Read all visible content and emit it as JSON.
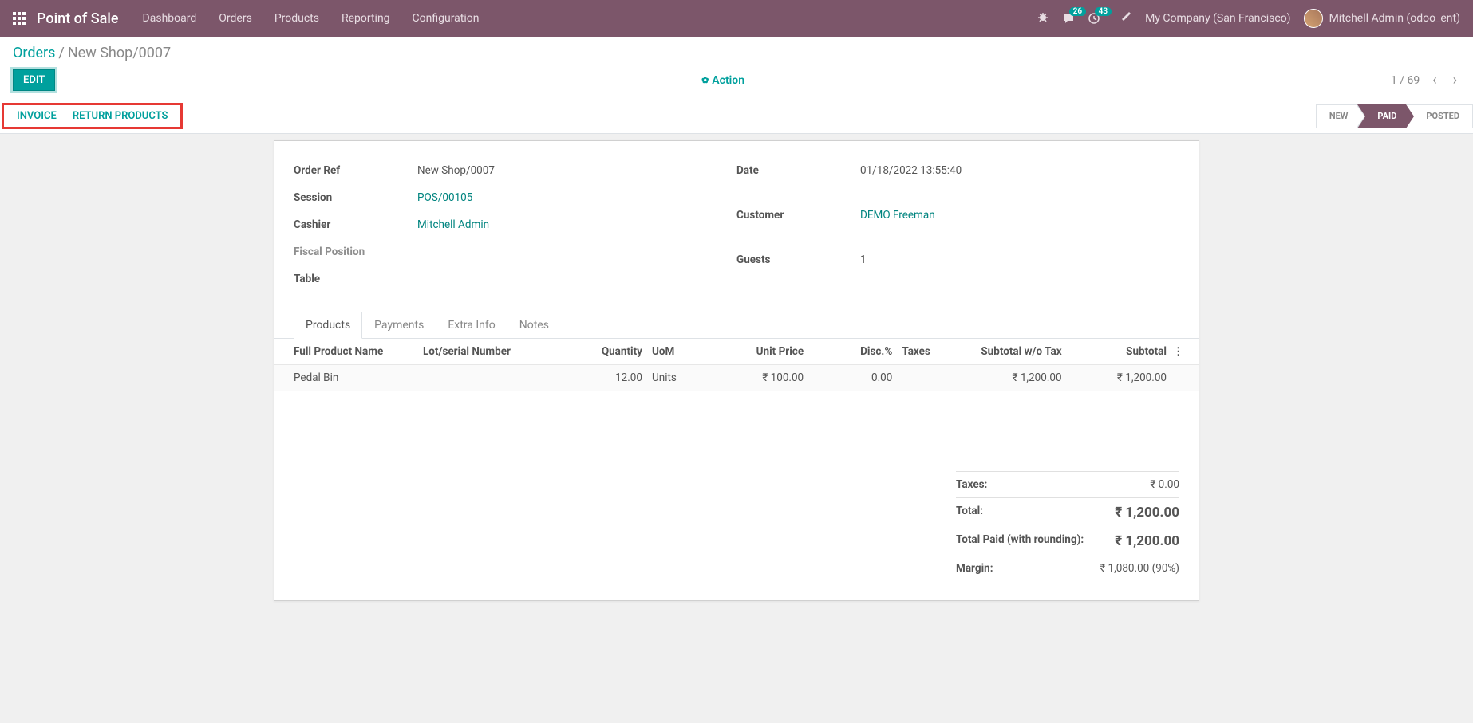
{
  "nav": {
    "app_title": "Point of Sale",
    "items": [
      "Dashboard",
      "Orders",
      "Products",
      "Reporting",
      "Configuration"
    ],
    "chat_count": "26",
    "activity_count": "43",
    "company": "My Company (San Francisco)",
    "user": "Mitchell Admin (odoo_ent)"
  },
  "breadcrumb": {
    "parent": "Orders",
    "current": "New Shop/0007"
  },
  "controls": {
    "edit": "EDIT",
    "action": "Action",
    "pager": "1 / 69"
  },
  "action_bar": {
    "invoice": "INVOICE",
    "return_products": "RETURN PRODUCTS"
  },
  "status_steps": [
    "NEW",
    "PAID",
    "POSTED"
  ],
  "fields": {
    "order_ref_label": "Order Ref",
    "order_ref": "New Shop/0007",
    "session_label": "Session",
    "session": "POS/00105",
    "cashier_label": "Cashier",
    "cashier": "Mitchell Admin",
    "fiscal_label": "Fiscal Position",
    "table_label": "Table",
    "date_label": "Date",
    "date": "01/18/2022 13:55:40",
    "customer_label": "Customer",
    "customer": "DEMO Freeman",
    "guests_label": "Guests",
    "guests": "1"
  },
  "tabs": [
    "Products",
    "Payments",
    "Extra Info",
    "Notes"
  ],
  "table": {
    "headers": {
      "product": "Full Product Name",
      "lot": "Lot/serial Number",
      "qty": "Quantity",
      "uom": "UoM",
      "unit_price": "Unit Price",
      "disc": "Disc.%",
      "taxes": "Taxes",
      "subtotal_wo": "Subtotal w/o Tax",
      "subtotal": "Subtotal"
    },
    "row": {
      "product": "Pedal Bin",
      "lot": "",
      "qty": "12.00",
      "uom": "Units",
      "unit_price": "₹ 100.00",
      "disc": "0.00",
      "taxes": "",
      "subtotal_wo": "₹ 1,200.00",
      "subtotal": "₹ 1,200.00"
    }
  },
  "totals": {
    "taxes_label": "Taxes:",
    "taxes": "₹ 0.00",
    "total_label": "Total:",
    "total": "₹ 1,200.00",
    "paid_label": "Total Paid (with rounding):",
    "paid": "₹ 1,200.00",
    "margin_label": "Margin:",
    "margin": "₹ 1,080.00 (90%)"
  }
}
